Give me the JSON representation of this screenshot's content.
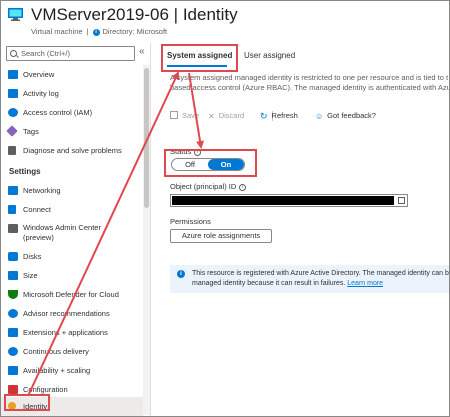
{
  "header": {
    "title": "VMServer2019-06 | Identity",
    "resource_type": "Virtual machine",
    "directory": "Directory: Microsoft",
    "more": "···"
  },
  "sidebar": {
    "search_placeholder": "Search (Ctrl+/)",
    "collapse": "«",
    "top_items": [
      {
        "label": "Overview",
        "icon": "monitor-icon",
        "color": "#0078d4"
      },
      {
        "label": "Activity log",
        "icon": "activity-log-icon",
        "color": "#0078d4"
      },
      {
        "label": "Access control (IAM)",
        "icon": "people-icon",
        "color": "#0078d4"
      },
      {
        "label": "Tags",
        "icon": "tag-icon",
        "color": "#8764b8"
      },
      {
        "label": "Diagnose and solve problems",
        "icon": "wrench-icon",
        "color": "#605e5c"
      }
    ],
    "section_title": "Settings",
    "settings_items": [
      {
        "label": "Networking",
        "icon": "network-icon",
        "color": "#0078d4"
      },
      {
        "label": "Connect",
        "icon": "connect-icon",
        "color": "#0078d4"
      },
      {
        "label": "Windows Admin Center",
        "label2": "(preview)",
        "icon": "admin-center-icon",
        "color": "#605e5c"
      },
      {
        "label": "Disks",
        "icon": "disk-icon",
        "color": "#0078d4"
      },
      {
        "label": "Size",
        "icon": "size-icon",
        "color": "#0078d4"
      },
      {
        "label": "Microsoft Defender for Cloud",
        "icon": "shield-icon",
        "color": "#107c10"
      },
      {
        "label": "Advisor recommendations",
        "icon": "advisor-icon",
        "color": "#0078d4"
      },
      {
        "label": "Extensions + applications",
        "icon": "extensions-icon",
        "color": "#0078d4"
      },
      {
        "label": "Continuous delivery",
        "icon": "delivery-icon",
        "color": "#0078d4"
      },
      {
        "label": "Availability + scaling",
        "icon": "availability-icon",
        "color": "#0078d4"
      },
      {
        "label": "Configuration",
        "icon": "configuration-icon",
        "color": "#d13438"
      },
      {
        "label": "Identity",
        "icon": "key-icon",
        "color": "#e3a21a"
      }
    ]
  },
  "main": {
    "tabs": [
      "System assigned",
      "User assigned"
    ],
    "description": "A system assigned managed identity is restricted to one per resource and is tied to t based access control (Azure RBAC). The managed identity is authenticated with Azur",
    "toolbar": {
      "save": "Save",
      "discard": "Discard",
      "refresh": "Refresh",
      "feedback": "Got feedback?"
    },
    "status_label": "Status",
    "toggle_off": "Off",
    "toggle_on": "On",
    "object_id_label": "Object (principal) ID",
    "permissions_label": "Permissions",
    "azure_role_button": "Azure role assignments",
    "banner_text": "This resource is registered with Azure Active Directory. The managed identity can b the managed identity because it can result in failures.",
    "banner_link": "Learn more"
  },
  "colors": {
    "accent": "#0078d4",
    "highlight": "#e0484f"
  }
}
